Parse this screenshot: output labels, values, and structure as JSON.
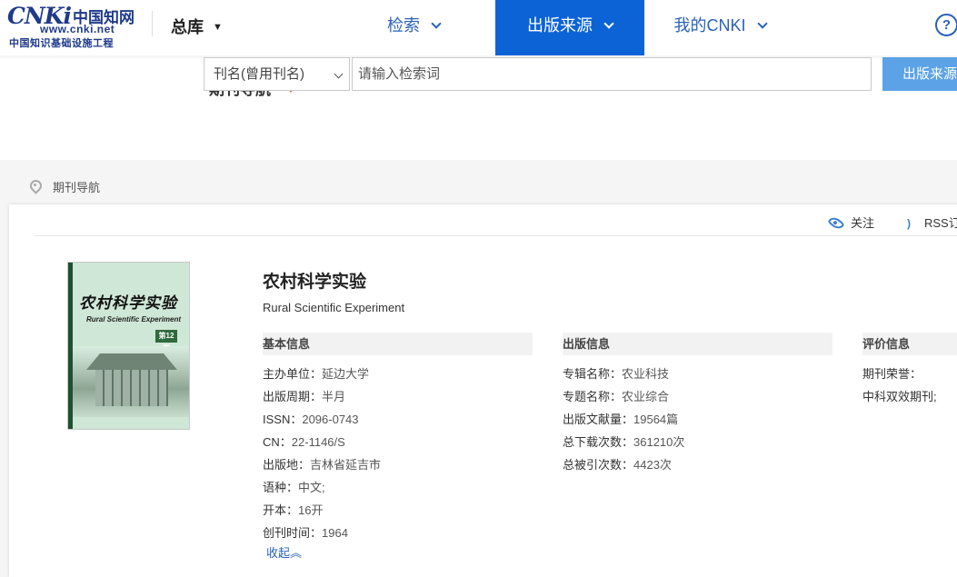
{
  "header": {
    "logo_mark": "CNKi",
    "logo_cn": "中国知网",
    "logo_url": "www.cnki.net",
    "logo_sub": "中国知识基础设施工程",
    "library": "总库",
    "nav": [
      {
        "label": "检索"
      },
      {
        "label": "出版来源"
      },
      {
        "label": "我的CNKI"
      }
    ],
    "help": "?"
  },
  "search": {
    "section_title": "期刊导航",
    "field_select": "刊名(曾用刊名)",
    "query_placeholder": "请输入检索词",
    "button": "出版来源"
  },
  "breadcrumb": {
    "label": "期刊导航"
  },
  "actions": {
    "follow": "关注",
    "rss": "RSS订"
  },
  "cover": {
    "title": "农村科学实验",
    "subtitle": "Rural Scientific Experiment",
    "issue": "第12期"
  },
  "journal": {
    "title": "农村科学实验",
    "english_title": "Rural Scientific Experiment",
    "basic": {
      "heading": "基本信息",
      "rows": [
        {
          "label": "主办单位：",
          "value": "延边大学"
        },
        {
          "label": "出版周期：",
          "value": "半月"
        },
        {
          "label": "ISSN：",
          "value": "2096-0743"
        },
        {
          "label": "CN：",
          "value": "22-1146/S"
        },
        {
          "label": "出版地：",
          "value": "吉林省延吉市"
        },
        {
          "label": "语种：",
          "value": "中文;"
        },
        {
          "label": "开本：",
          "value": "16开"
        },
        {
          "label": "创刊时间：",
          "value": "1964"
        }
      ]
    },
    "publish": {
      "heading": "出版信息",
      "rows": [
        {
          "label": "专辑名称：",
          "value": "农业科技"
        },
        {
          "label": "专题名称：",
          "value": "农业综合"
        },
        {
          "label": "出版文献量：",
          "value": "19564篇"
        },
        {
          "label": "总下载次数：",
          "value": "361210次"
        },
        {
          "label": "总被引次数：",
          "value": "4423次"
        }
      ]
    },
    "evaluation": {
      "heading": "评价信息",
      "honor_label": "期刊荣誉：",
      "honor_value": "中科双效期刊;"
    },
    "collapse": "收起"
  }
}
